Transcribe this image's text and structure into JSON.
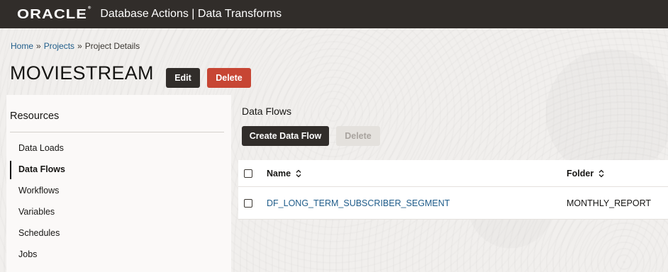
{
  "header": {
    "logo_text": "ORACLE",
    "logo_mark": "®",
    "app_title": "Database Actions | Data Transforms"
  },
  "breadcrumb": {
    "items": [
      {
        "label": "Home",
        "link": true
      },
      {
        "label": "Projects",
        "link": true
      },
      {
        "label": "Project Details",
        "link": false
      }
    ],
    "separator": "»"
  },
  "page": {
    "title": "MOVIESTREAM",
    "edit_label": "Edit",
    "delete_label": "Delete"
  },
  "sidebar": {
    "heading": "Resources",
    "items": [
      {
        "label": "Data Loads",
        "active": false
      },
      {
        "label": "Data Flows",
        "active": true
      },
      {
        "label": "Workflows",
        "active": false
      },
      {
        "label": "Variables",
        "active": false
      },
      {
        "label": "Schedules",
        "active": false
      },
      {
        "label": "Jobs",
        "active": false
      }
    ]
  },
  "main": {
    "section_title": "Data Flows",
    "create_label": "Create Data Flow",
    "delete_label": "Delete",
    "table": {
      "columns": [
        "Name",
        "Folder"
      ],
      "rows": [
        {
          "name": "DF_LONG_TERM_SUBSCRIBER_SEGMENT",
          "folder": "MONTHLY_REPORT"
        }
      ]
    }
  },
  "colors": {
    "topbar": "#312d2a",
    "primary_button": "#312d2a",
    "danger_button": "#c74634",
    "link": "#1f5c8a"
  }
}
